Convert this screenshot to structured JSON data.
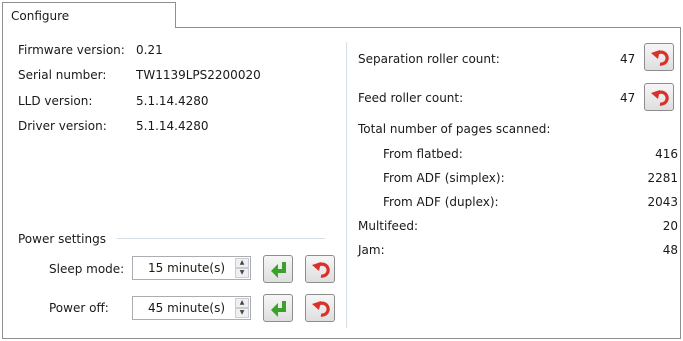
{
  "tabs": [
    {
      "label": "Configure"
    }
  ],
  "info": {
    "firmware_label": "Firmware version:",
    "firmware_value": "0.21",
    "serial_label": "Serial number:",
    "serial_value": "TW1139LPS2200020",
    "lld_label": "LLD version:",
    "lld_value": "5.1.14.4280",
    "driver_label": "Driver version:",
    "driver_value": "5.1.14.4280"
  },
  "power": {
    "group_label": "Power settings",
    "sleep_label": "Sleep mode:",
    "sleep_value": "15 minute(s)",
    "poweroff_label": "Power off:",
    "poweroff_value": "45 minute(s)"
  },
  "counts": {
    "separation_label": "Separation roller count:",
    "separation_value": "47",
    "feed_label": "Feed roller count:",
    "feed_value": "47",
    "total_label": "Total number of pages scanned:",
    "flatbed_label": "From flatbed:",
    "flatbed_value": "416",
    "simplex_label": "From ADF (simplex):",
    "simplex_value": "2281",
    "duplex_label": "From ADF (duplex):",
    "duplex_value": "2043",
    "multifeed_label": "Multifeed:",
    "multifeed_value": "20",
    "jam_label": "Jam:",
    "jam_value": "48"
  },
  "icons": {
    "apply": "enter-arrow-icon",
    "reset": "undo-arrow-icon",
    "apply_color": "#3aa12a",
    "reset_color": "#d9302a"
  }
}
